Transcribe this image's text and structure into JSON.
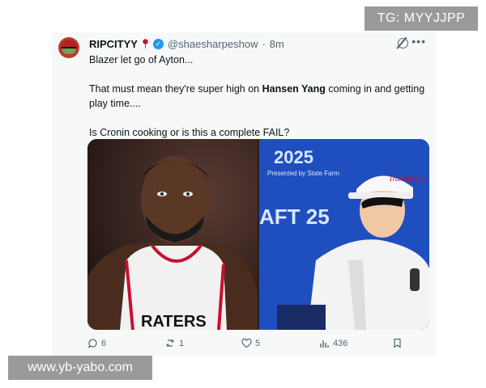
{
  "overlays": {
    "top_right_label": "TG: MYYJJPP",
    "bottom_left_label": "www.yb-yabo.com"
  },
  "tweet": {
    "display_name": "RIPCITYY",
    "handle": "@shaesharpeshow",
    "separator": "·",
    "time": "8m",
    "lines": {
      "line1": "Blazer let go of Ayton...",
      "line2_pre": "That must mean they're super high on ",
      "line2_bold": "Hansen Yang",
      "line2_post": " coming in and getting play time....",
      "line3": "Is Cronin cooking or is this a complete FAIL?"
    },
    "actions": {
      "replies": "6",
      "reposts": "1",
      "likes": "5",
      "views": "436"
    },
    "icons": {
      "avatar": "avatar-icon",
      "rose": "rose-icon",
      "verified": "verified-icon",
      "grok": "grok-icon",
      "more": "more-icon",
      "reply": "reply-icon",
      "repost": "repost-icon",
      "like": "heart-icon",
      "views": "views-icon",
      "bookmark": "bookmark-icon"
    },
    "media_text": {
      "jersey": "RATERS",
      "backdrop_year": "2025",
      "backdrop_sponsor": "Presented by State Farm",
      "backdrop_draft": "AFT 25",
      "cap_text": "Trail Blazers"
    }
  },
  "colors": {
    "verified_blue": "#1d9bf0",
    "card_bg": "#f7f9f9",
    "muted_text": "#536471"
  }
}
